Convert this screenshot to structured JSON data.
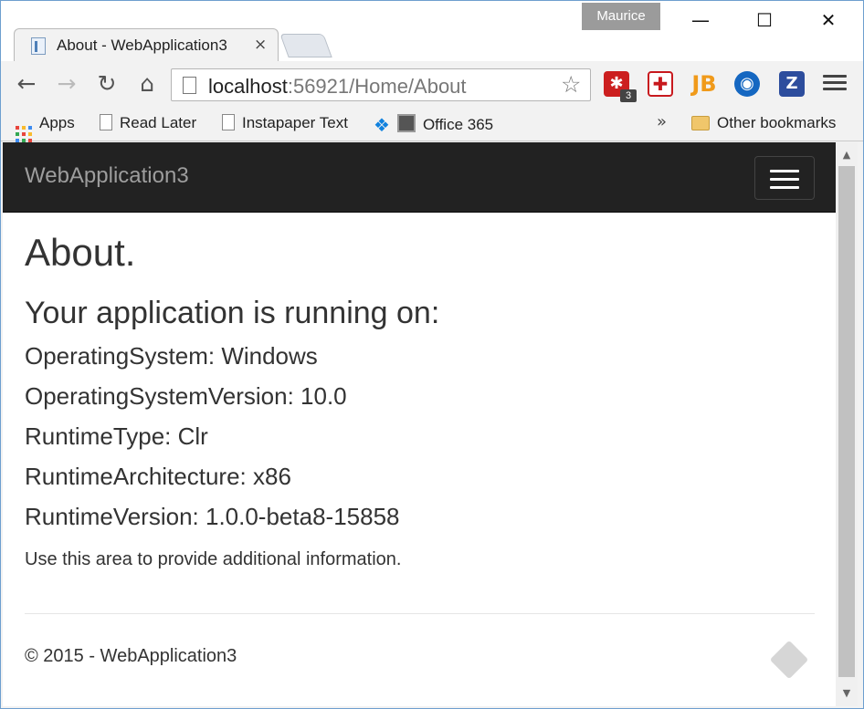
{
  "window": {
    "profile_name": "Maurice",
    "minimize": "—",
    "maximize": "☐",
    "close": "✕"
  },
  "tab": {
    "title": "About - WebApplication3",
    "close": "×"
  },
  "toolbar": {
    "back": "←",
    "forward": "→",
    "reload": "↻",
    "home": "⌂",
    "url_host": "localhost",
    "url_rest": ":56921/Home/About",
    "star": "☆",
    "extensions": [
      {
        "name": "lastpass",
        "glyph": "✱",
        "badge": "3"
      },
      {
        "name": "timer",
        "glyph": "✚"
      },
      {
        "name": "jetbrains",
        "glyph": "JB"
      },
      {
        "name": "blue-circle",
        "glyph": "◉"
      },
      {
        "name": "zotero",
        "glyph": "Z"
      }
    ]
  },
  "bookmarks": {
    "items": [
      "Apps",
      "Read Later",
      "Instapaper Text",
      "Office 365"
    ],
    "overflow": "»",
    "other": "Other bookmarks"
  },
  "site": {
    "brand": "WebApplication3",
    "heading": "About.",
    "subheading": "Your application is running on:",
    "info": [
      "OperatingSystem: Windows",
      "OperatingSystemVersion: 10.0",
      "RuntimeType: Clr",
      "RuntimeArchitecture: x86",
      "RuntimeVersion: 1.0.0-beta8-15858"
    ],
    "paragraph": "Use this area to provide additional information.",
    "footer": "© 2015 - WebApplication3"
  },
  "scrollbar": {
    "up": "▲",
    "down": "▼"
  },
  "colors": {
    "navbar": "#222222",
    "brand": "#9d9d9d",
    "lastpass": "#cc1f1f",
    "zotero": "#2d4d9d"
  }
}
